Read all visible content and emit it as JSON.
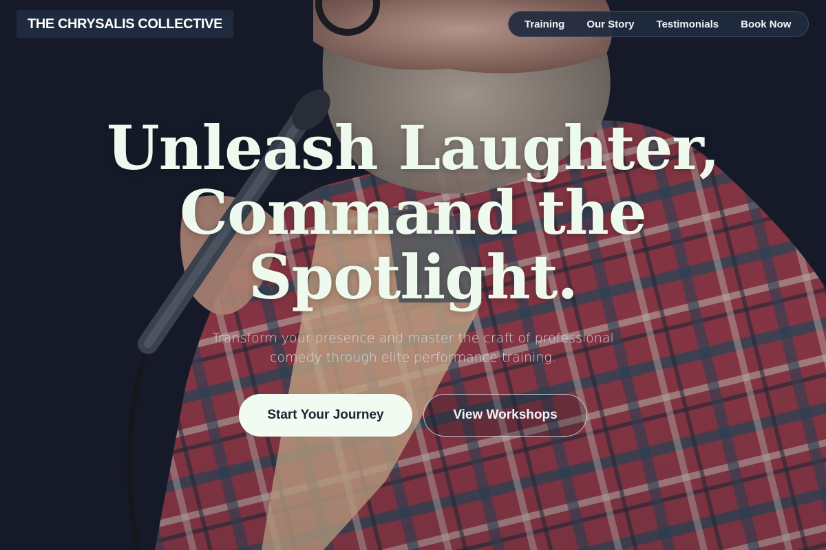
{
  "brand": {
    "logo_text": "THE CHRYSALIS COLLECTIVE"
  },
  "nav": {
    "items": [
      {
        "label": "Training"
      },
      {
        "label": "Our Story"
      },
      {
        "label": "Testimonials"
      },
      {
        "label": "Book Now"
      }
    ]
  },
  "hero": {
    "headline_lines": [
      "Unleash Laughter,",
      "Command the",
      "Spotlight."
    ],
    "subtitle": "Transform your presence and master the craft of professional comedy through elite performance training.",
    "primary_cta": "Start Your Journey",
    "secondary_cta": "View Workshops"
  },
  "colors": {
    "background": "#161a28",
    "logo_bg": "#1f2a3e",
    "nav_bg": "#202a3e",
    "headline": "#effaee",
    "primary_button_bg": "#f2fbf1",
    "primary_button_text": "#1a2233"
  }
}
